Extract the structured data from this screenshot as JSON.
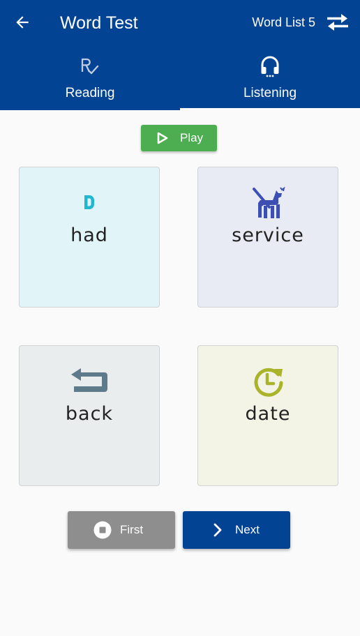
{
  "header": {
    "title": "Word Test",
    "list_label": "Word List 5",
    "back_icon": "arrow-left-icon",
    "swap_icon": "swap-arrows-icon"
  },
  "tabs": [
    {
      "label": "Reading",
      "icon": "reading-check-icon",
      "active": false
    },
    {
      "label": "Listening",
      "icon": "headphones-icon",
      "active": true
    }
  ],
  "play_button": {
    "label": "Play",
    "icon": "play-icon"
  },
  "cards": [
    {
      "word": "had",
      "icon": "letter-d-icon",
      "bg": "#e1f5f8",
      "icon_color": "#1fb8d0"
    },
    {
      "word": "service",
      "icon": "service-dog-icon",
      "bg": "#e8eaf4",
      "icon_color": "#3e4fb4"
    },
    {
      "word": "back",
      "icon": "return-arrow-icon",
      "bg": "#e9edee",
      "icon_color": "#5e7b8b"
    },
    {
      "word": "date",
      "icon": "clock-refresh-icon",
      "bg": "#f3f4e5",
      "icon_color": "#aab42a"
    }
  ],
  "footer": {
    "first_label": "First",
    "first_icon": "stop-circle-icon",
    "next_label": "Next",
    "next_icon": "chevron-right-icon"
  },
  "colors": {
    "primary": "#024394",
    "play": "#4cae50",
    "first_button": "#8e8e8e",
    "next_button": "#024394"
  }
}
